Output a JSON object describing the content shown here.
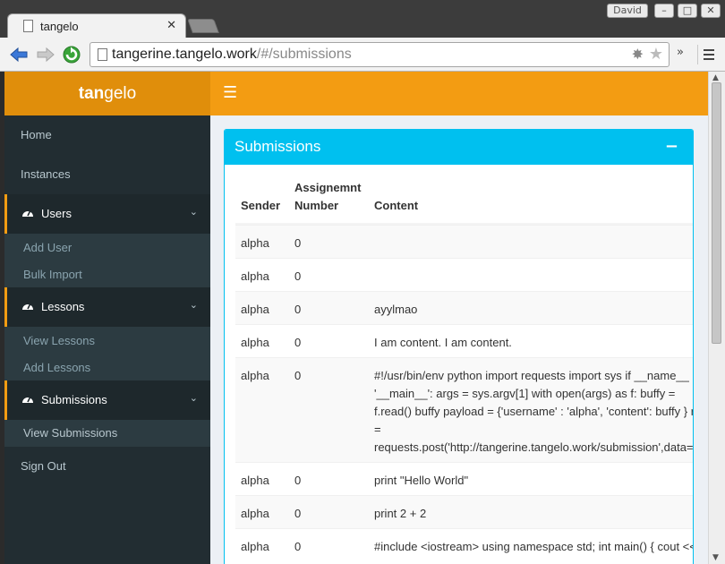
{
  "browser": {
    "user_name": "David",
    "tab_title": "tangelo",
    "url_host": "tangerine.tangelo.work",
    "url_path": "/#/submissions",
    "more_label": "»"
  },
  "app": {
    "logo_bold": "tan",
    "logo_rest": "gelo",
    "accent_color": "#f39c12"
  },
  "sidebar": {
    "home": "Home",
    "instances": "Instances",
    "users": "Users",
    "add_user": "Add User",
    "bulk_import": "Bulk Import",
    "lessons": "Lessons",
    "view_lessons": "View Lessons",
    "add_lessons": "Add Lessons",
    "submissions": "Submissions",
    "view_submissions": "View Submissions",
    "sign_out": "Sign Out"
  },
  "box": {
    "title": "Submissions",
    "collapse": "−"
  },
  "table": {
    "headers": [
      "Sender",
      "Assignemnt\nNumber",
      "Content"
    ],
    "rows": [
      {
        "sender": "alpha",
        "number": "0",
        "content": ""
      },
      {
        "sender": "alpha",
        "number": "0",
        "content": ""
      },
      {
        "sender": "alpha",
        "number": "0",
        "content": "ayylmao"
      },
      {
        "sender": "alpha",
        "number": "0",
        "content": "I am content. I am content."
      },
      {
        "sender": "alpha",
        "number": "0",
        "content": "#!/usr/bin/env python import requests import sys if __name__ == '__main__': args = sys.argv[1] with open(args) as f: buffy = f.read() buffy payload = {'username' : 'alpha', 'content': buffy } req = requests.post('http://tangerine.tangelo.work/submission',data=payload) print req"
      },
      {
        "sender": "alpha",
        "number": "0",
        "content": "print \"Hello World\""
      },
      {
        "sender": "alpha",
        "number": "0",
        "content": "print 2 + 2"
      },
      {
        "sender": "alpha",
        "number": "0",
        "content": "#include <iostream> using namespace std; int main() { cout << \"Hello World\" << endl; }"
      }
    ]
  }
}
